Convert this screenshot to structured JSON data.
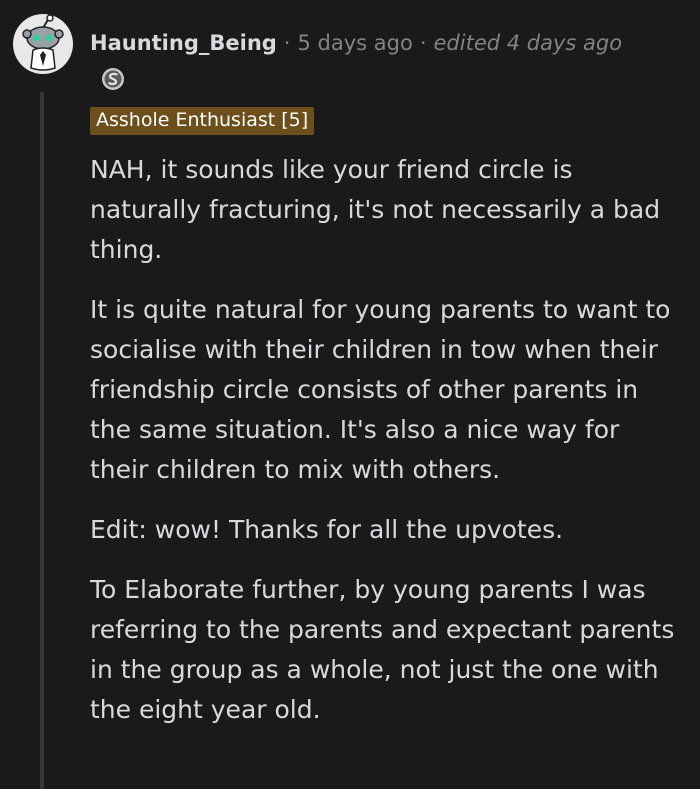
{
  "comment": {
    "username": "Haunting_Being",
    "separator": "·",
    "age": "5 days ago",
    "edited": "edited 4 days ago",
    "flair": "Asshole Enthusiast [5]",
    "award_icon": "silver-award-icon",
    "avatar_icon": "snoo-avatar-icon",
    "paragraphs": [
      "NAH, it sounds like your friend circle is naturally fracturing, it's not necessarily a bad thing.",
      "It is quite natural for young parents to want to socialise with their children in tow when their friendship circle consists of other parents in the same situation. It's also a nice way for their children to mix with others.",
      "Edit: wow! Thanks for all the upvotes.",
      "To Elaborate further, by young parents I was referring to the parents and expectant parents in the group as a whole, not just the one with the eight year old."
    ]
  },
  "colors": {
    "background": "#1a1a1b",
    "text": "#d7dadc",
    "meta": "#818384",
    "flair_bg": "#6c4f1a",
    "thread_line": "#343536"
  }
}
